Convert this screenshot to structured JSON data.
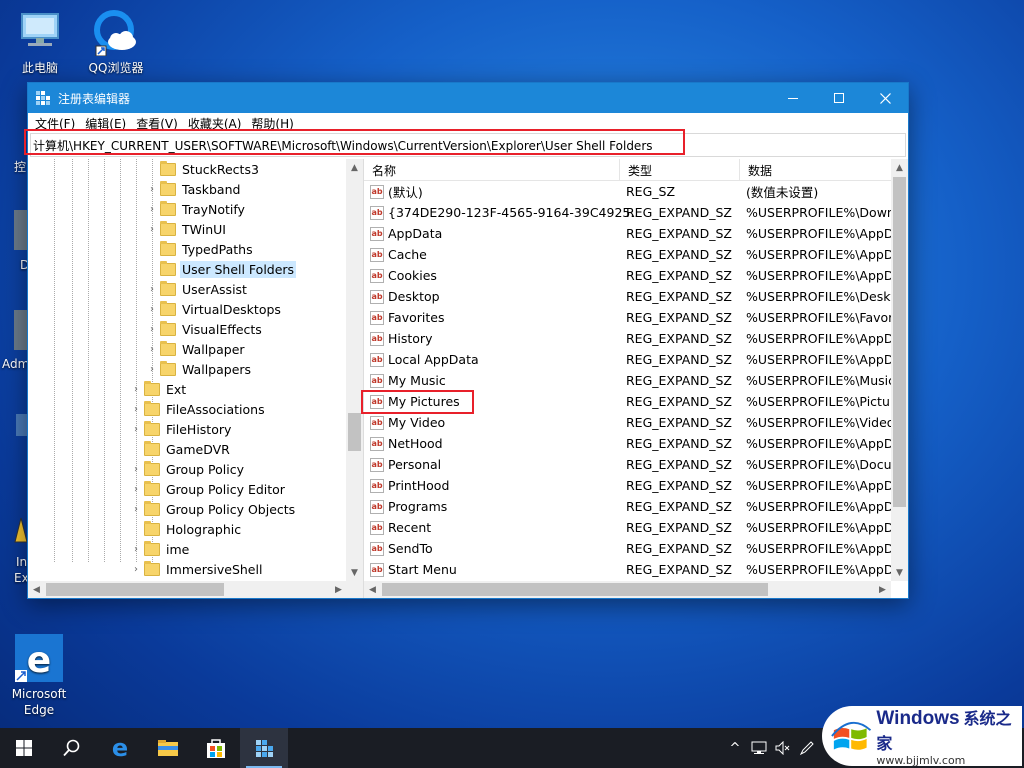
{
  "desktop": {
    "icons": [
      {
        "label": "此电脑"
      },
      {
        "label": "QQ浏览器"
      },
      {
        "label": "Microsoft\nEdge"
      }
    ],
    "partial_labels": [
      "控",
      "D",
      "Adm",
      "In",
      "Ex"
    ]
  },
  "window": {
    "title": "注册表编辑器",
    "minimize_glyph": "—",
    "maximize_glyph": "☐",
    "close_glyph": "✕"
  },
  "menu": [
    "文件(F)",
    "编辑(E)",
    "查看(V)",
    "收藏夹(A)",
    "帮助(H)"
  ],
  "address": "计算机\\HKEY_CURRENT_USER\\SOFTWARE\\Microsoft\\Windows\\CurrentVersion\\Explorer\\User Shell Folders",
  "tree": [
    {
      "label": "StuckRects3",
      "level": 2,
      "chevron": "",
      "selected": false
    },
    {
      "label": "Taskband",
      "level": 2,
      "chevron": "›",
      "selected": false
    },
    {
      "label": "TrayNotify",
      "level": 2,
      "chevron": "›",
      "selected": false
    },
    {
      "label": "TWinUI",
      "level": 2,
      "chevron": "›",
      "selected": false
    },
    {
      "label": "TypedPaths",
      "level": 2,
      "chevron": "",
      "selected": false
    },
    {
      "label": "User Shell Folders",
      "level": 2,
      "chevron": "",
      "selected": true
    },
    {
      "label": "UserAssist",
      "level": 2,
      "chevron": "›",
      "selected": false
    },
    {
      "label": "VirtualDesktops",
      "level": 2,
      "chevron": "›",
      "selected": false
    },
    {
      "label": "VisualEffects",
      "level": 2,
      "chevron": "›",
      "selected": false
    },
    {
      "label": "Wallpaper",
      "level": 2,
      "chevron": "›",
      "selected": false
    },
    {
      "label": "Wallpapers",
      "level": 2,
      "chevron": "›",
      "selected": false
    },
    {
      "label": "Ext",
      "level": 1,
      "chevron": "›",
      "selected": false
    },
    {
      "label": "FileAssociations",
      "level": 1,
      "chevron": "›",
      "selected": false
    },
    {
      "label": "FileHistory",
      "level": 1,
      "chevron": "›",
      "selected": false
    },
    {
      "label": "GameDVR",
      "level": 1,
      "chevron": "",
      "selected": false
    },
    {
      "label": "Group Policy",
      "level": 1,
      "chevron": "›",
      "selected": false
    },
    {
      "label": "Group Policy Editor",
      "level": 1,
      "chevron": "›",
      "selected": false
    },
    {
      "label": "Group Policy Objects",
      "level": 1,
      "chevron": "›",
      "selected": false
    },
    {
      "label": "Holographic",
      "level": 1,
      "chevron": "",
      "selected": false
    },
    {
      "label": "ime",
      "level": 1,
      "chevron": "›",
      "selected": false
    },
    {
      "label": "ImmersiveShell",
      "level": 1,
      "chevron": "›",
      "selected": false
    }
  ],
  "columns": {
    "name": "名称",
    "type": "类型",
    "data": "数据"
  },
  "values": [
    {
      "name": "(默认)",
      "type": "REG_SZ",
      "data": "(数值未设置)",
      "highlight": false
    },
    {
      "name": "{374DE290-123F-4565-9164-39C4925...",
      "type": "REG_EXPAND_SZ",
      "data": "%USERPROFILE%\\Downl",
      "highlight": false
    },
    {
      "name": "AppData",
      "type": "REG_EXPAND_SZ",
      "data": "%USERPROFILE%\\AppDa",
      "highlight": false
    },
    {
      "name": "Cache",
      "type": "REG_EXPAND_SZ",
      "data": "%USERPROFILE%\\AppDa",
      "highlight": false
    },
    {
      "name": "Cookies",
      "type": "REG_EXPAND_SZ",
      "data": "%USERPROFILE%\\AppDa",
      "highlight": false
    },
    {
      "name": "Desktop",
      "type": "REG_EXPAND_SZ",
      "data": "%USERPROFILE%\\Deskto",
      "highlight": false
    },
    {
      "name": "Favorites",
      "type": "REG_EXPAND_SZ",
      "data": "%USERPROFILE%\\Favorit",
      "highlight": false
    },
    {
      "name": "History",
      "type": "REG_EXPAND_SZ",
      "data": "%USERPROFILE%\\AppDa",
      "highlight": false
    },
    {
      "name": "Local AppData",
      "type": "REG_EXPAND_SZ",
      "data": "%USERPROFILE%\\AppDa",
      "highlight": false
    },
    {
      "name": "My Music",
      "type": "REG_EXPAND_SZ",
      "data": "%USERPROFILE%\\Music",
      "highlight": false
    },
    {
      "name": "My Pictures",
      "type": "REG_EXPAND_SZ",
      "data": "%USERPROFILE%\\Picture",
      "highlight": true
    },
    {
      "name": "My Video",
      "type": "REG_EXPAND_SZ",
      "data": "%USERPROFILE%\\Videos",
      "highlight": false
    },
    {
      "name": "NetHood",
      "type": "REG_EXPAND_SZ",
      "data": "%USERPROFILE%\\AppDa",
      "highlight": false
    },
    {
      "name": "Personal",
      "type": "REG_EXPAND_SZ",
      "data": "%USERPROFILE%\\Docum",
      "highlight": false
    },
    {
      "name": "PrintHood",
      "type": "REG_EXPAND_SZ",
      "data": "%USERPROFILE%\\AppDa",
      "highlight": false
    },
    {
      "name": "Programs",
      "type": "REG_EXPAND_SZ",
      "data": "%USERPROFILE%\\AppDa",
      "highlight": false
    },
    {
      "name": "Recent",
      "type": "REG_EXPAND_SZ",
      "data": "%USERPROFILE%\\AppDa",
      "highlight": false
    },
    {
      "name": "SendTo",
      "type": "REG_EXPAND_SZ",
      "data": "%USERPROFILE%\\AppDa",
      "highlight": false
    },
    {
      "name": "Start Menu",
      "type": "REG_EXPAND_SZ",
      "data": "%USERPROFILE%\\AppDa",
      "highlight": false
    }
  ],
  "value_icon_text": "ab",
  "taskbar": {
    "tray_chevron": "^"
  },
  "watermark": {
    "brand": "Windows",
    "cn": "系统之家",
    "url": "www.bjjmlv.com"
  },
  "colors": {
    "titlebar": "#1c87d8",
    "highlight_box": "#e8202a",
    "selection": "#cce8ff"
  }
}
